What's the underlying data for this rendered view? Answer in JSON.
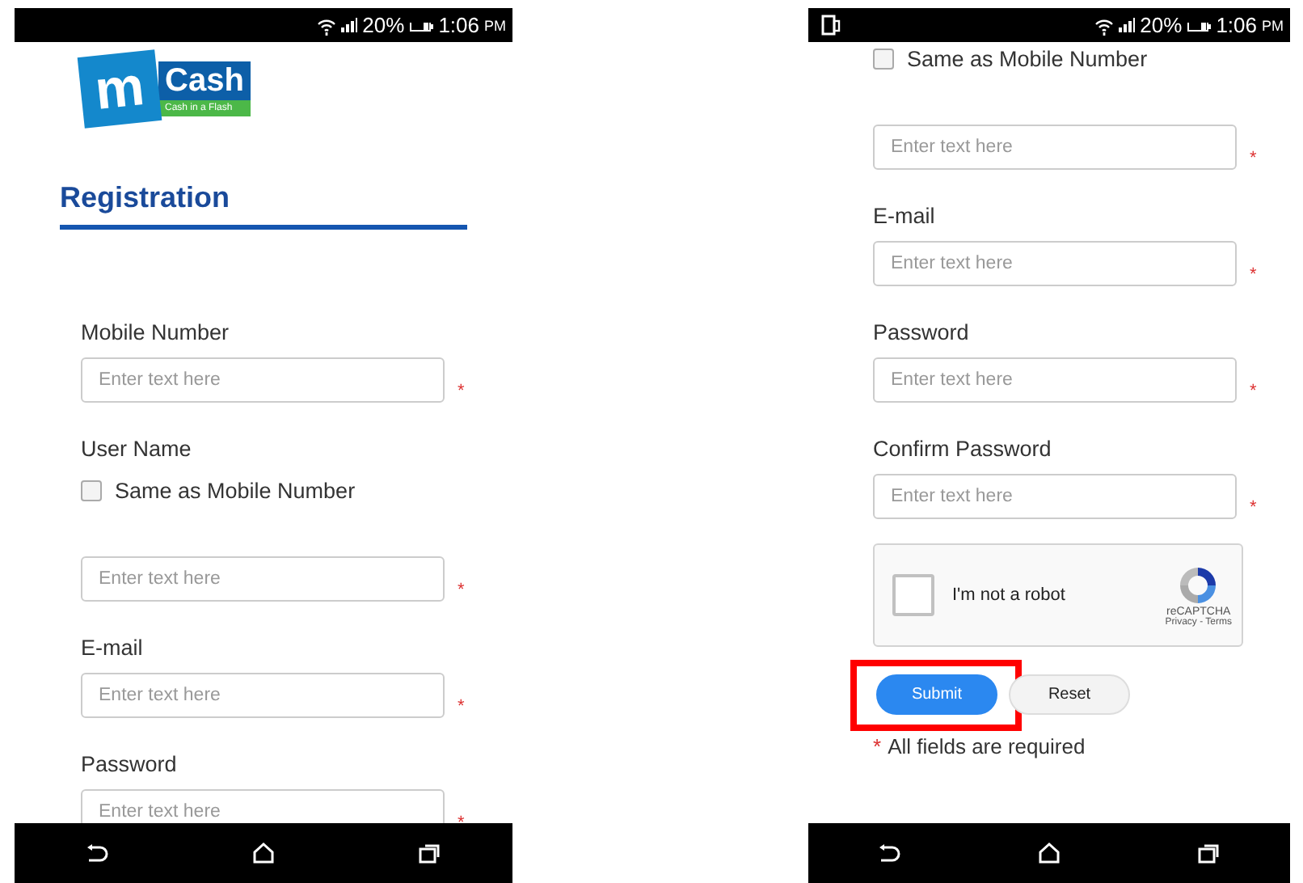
{
  "screens": [
    {
      "status_bar": {
        "rotate_icon": false,
        "battery": "20%",
        "time": "1:06",
        "meridiem": "PM"
      },
      "logo": {
        "letter": "m",
        "name": "Cash",
        "tagline": "Cash in a Flash"
      },
      "heading": "Registration",
      "form": [
        {
          "kind": "label",
          "text": "Mobile Number"
        },
        {
          "kind": "input",
          "placeholder": "Enter text here",
          "mark": "*"
        },
        {
          "kind": "label",
          "text": "User Name"
        },
        {
          "kind": "checkbox",
          "text": "Same as Mobile Number",
          "checked": false
        },
        {
          "kind": "input",
          "placeholder": "Enter text here",
          "mark": "*"
        },
        {
          "kind": "label",
          "text": "E-mail"
        },
        {
          "kind": "input",
          "placeholder": "Enter text here",
          "mark": "*"
        },
        {
          "kind": "label",
          "text": "Password"
        },
        {
          "kind": "input",
          "placeholder": "Enter text here",
          "mark": "*"
        }
      ]
    },
    {
      "status_bar": {
        "rotate_icon": true,
        "battery": "20%",
        "time": "1:06",
        "meridiem": "PM"
      },
      "form": [
        {
          "kind": "checkbox",
          "text": "Same as Mobile Number",
          "checked": false
        },
        {
          "kind": "input",
          "placeholder": "Enter text here",
          "mark": "*"
        },
        {
          "kind": "label",
          "text": "E-mail"
        },
        {
          "kind": "input",
          "placeholder": "Enter text here",
          "mark": "*"
        },
        {
          "kind": "label",
          "text": "Password"
        },
        {
          "kind": "input",
          "placeholder": "Enter text here",
          "mark": "*"
        },
        {
          "kind": "label",
          "text": "Confirm Password"
        },
        {
          "kind": "input",
          "placeholder": "Enter text here",
          "mark": "*"
        },
        {
          "kind": "captcha",
          "text": "I'm not a robot",
          "checked": false,
          "brand": "reCAPTCHA",
          "links": "Privacy - Terms"
        },
        {
          "kind": "buttons",
          "buttons": [
            {
              "label": "Submit",
              "primary": true,
              "highlighted": true
            },
            {
              "label": "Reset",
              "primary": false,
              "highlighted": false
            }
          ]
        },
        {
          "kind": "note",
          "marker": "*",
          "text": "All fields are required"
        }
      ]
    }
  ]
}
